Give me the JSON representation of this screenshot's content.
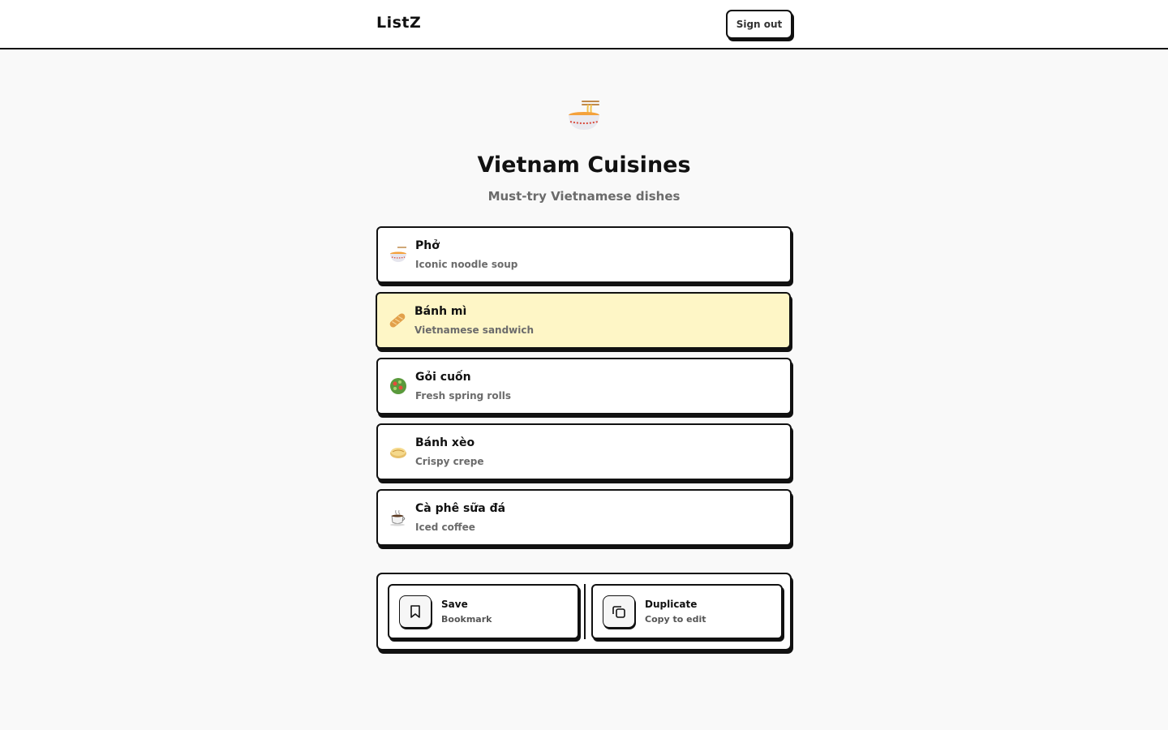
{
  "header": {
    "brand": "ListZ",
    "sign_out_label": "Sign out"
  },
  "list": {
    "icon": "steaming-bowl-icon",
    "title": "Vietnam Cuisines",
    "subtitle": "Must-try Vietnamese dishes"
  },
  "items": [
    {
      "name": "Phở",
      "description": "Iconic noodle soup",
      "icon": "noodle-bowl-icon"
    },
    {
      "name": "Bánh mì",
      "description": "Vietnamese sandwich",
      "icon": "baguette-icon",
      "highlighted": true
    },
    {
      "name": "Gỏi cuốn",
      "description": "Fresh spring rolls",
      "icon": "salad-icon"
    },
    {
      "name": "Bánh xèo",
      "description": "Crispy crepe",
      "icon": "crepe-icon"
    },
    {
      "name": "Cà phê sữa đá",
      "description": "Iced coffee",
      "icon": "coffee-cup-icon"
    }
  ],
  "actions": {
    "save": {
      "label": "Save",
      "sub": "Bookmark",
      "icon": "bookmark-icon"
    },
    "duplicate": {
      "label": "Duplicate",
      "sub": "Copy to edit",
      "icon": "copy-icon"
    }
  },
  "colors": {
    "highlight": "#fef6c6",
    "border": "#111111",
    "muted_text": "#6b6b6b",
    "page_bg": "#f9f9f9"
  }
}
